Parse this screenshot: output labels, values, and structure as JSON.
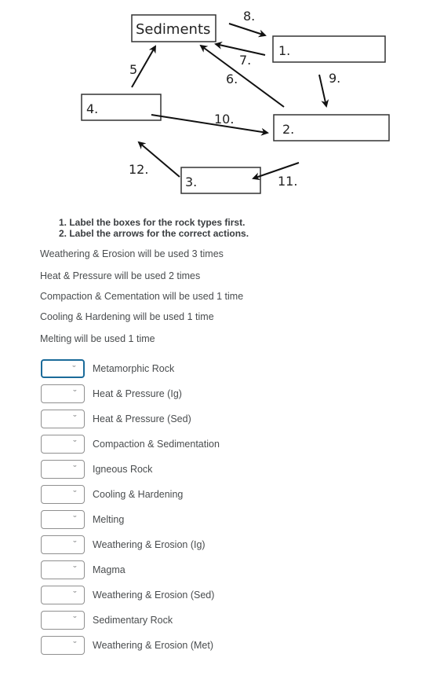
{
  "diagram": {
    "boxes": [
      {
        "id": "sediments",
        "label": "Sediments"
      },
      {
        "id": "box1",
        "label": "1."
      },
      {
        "id": "box2",
        "label": "2."
      },
      {
        "id": "box3",
        "label": "3."
      },
      {
        "id": "box4",
        "label": "4."
      }
    ],
    "arrow_labels": {
      "a5": "5",
      "a6": "6.",
      "a7": "7.",
      "a8": "8.",
      "a9": "9.",
      "a10": "10.",
      "a11": "11.",
      "a12": "12."
    }
  },
  "instructions": [
    "1. Label the boxes for the rock types first.",
    "2. Label the arrows for the correct actions."
  ],
  "usage": [
    "Weathering & Erosion will be used 3 times",
    "Heat & Pressure will be used 2 times",
    "Compaction & Cementation will be used 1 time",
    "Cooling & Hardening will be used 1 time",
    "Melting will be used 1 time"
  ],
  "matching": {
    "chevron_icon": "chevron-down-icon",
    "items": [
      {
        "label": "Metamorphic Rock",
        "selected": ""
      },
      {
        "label": "Heat & Pressure (Ig)",
        "selected": ""
      },
      {
        "label": "Heat & Pressure (Sed)",
        "selected": ""
      },
      {
        "label": "Compaction & Sedimentation",
        "selected": ""
      },
      {
        "label": "Igneous Rock",
        "selected": ""
      },
      {
        "label": "Cooling & Hardening",
        "selected": ""
      },
      {
        "label": "Melting",
        "selected": ""
      },
      {
        "label": "Weathering & Erosion (Ig)",
        "selected": ""
      },
      {
        "label": "Magma",
        "selected": ""
      },
      {
        "label": "Weathering & Erosion (Sed)",
        "selected": ""
      },
      {
        "label": "Sedimentary Rock",
        "selected": ""
      },
      {
        "label": "Weathering & Erosion (Met)",
        "selected": ""
      }
    ]
  },
  "colors": {
    "focus_border": "#1b6b9a",
    "select_border": "#909090",
    "text": "#494c4e"
  }
}
